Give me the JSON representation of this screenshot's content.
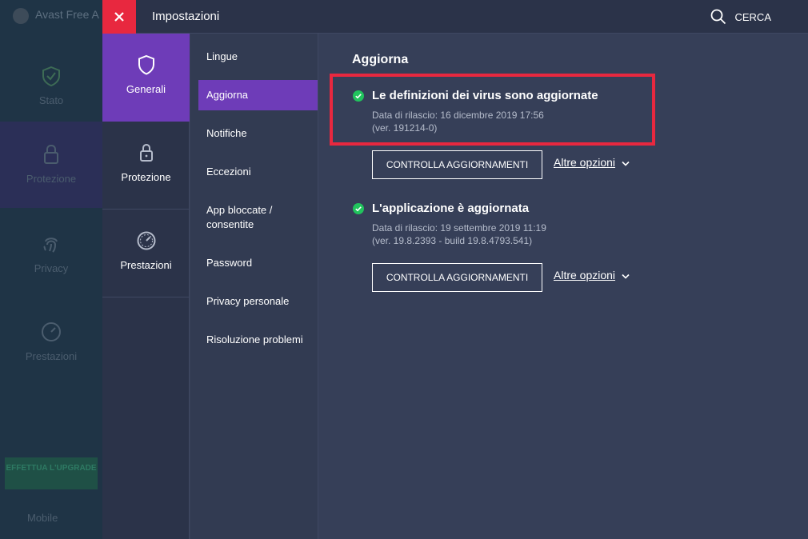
{
  "background": {
    "app_title": "Avast Free A",
    "nav": [
      {
        "label": "Stato"
      },
      {
        "label": "Protezione"
      },
      {
        "label": "Privacy"
      },
      {
        "label": "Prestazioni"
      }
    ],
    "upgrade_label": "EFFETTUA L'UPGRADE",
    "mobile_label": "Mobile"
  },
  "settings": {
    "title": "Impostazioni",
    "search_label": "CERCA",
    "categories": [
      {
        "label": "Generali",
        "icon": "shield-icon",
        "active": true
      },
      {
        "label": "Protezione",
        "icon": "lock-icon",
        "active": false
      },
      {
        "label": "Prestazioni",
        "icon": "gauge-icon",
        "active": false
      }
    ],
    "subnav": [
      {
        "label": "Lingue"
      },
      {
        "label": "Aggiorna",
        "active": true
      },
      {
        "label": "Notifiche"
      },
      {
        "label": "Eccezioni"
      },
      {
        "label": "App bloccate / consentite"
      },
      {
        "label": "Password"
      },
      {
        "label": "Privacy personale"
      },
      {
        "label": "Risoluzione problemi"
      }
    ]
  },
  "content": {
    "title": "Aggiorna",
    "definitions": {
      "title": "Le definizioni dei virus sono aggiornate",
      "release": "Data di rilascio: 16 dicembre 2019 17:56",
      "version": "(ver. 191214-0)",
      "button": "CONTROLLA AGGIORNAMENTI",
      "more": "Altre opzioni"
    },
    "application": {
      "title": "L'applicazione è aggiornata",
      "release": "Data di rilascio: 19 settembre 2019 11:19",
      "version": "(ver. 19.8.2393 - build 19.8.4793.541)",
      "button": "CONTROLLA AGGIORNAMENTI",
      "more": "Altre opzioni"
    }
  },
  "colors": {
    "accent": "#6e3cb8",
    "close": "#e8283f",
    "success": "#21c45d",
    "highlight": "#e8283f"
  }
}
